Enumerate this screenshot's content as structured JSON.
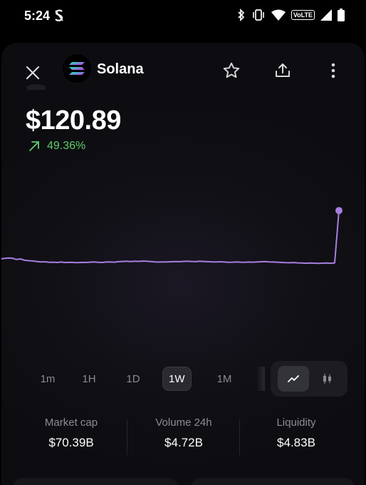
{
  "status_bar": {
    "time": "5:24",
    "volte": "VoLTE"
  },
  "header": {
    "token_name": "Solana",
    "icons": [
      "close-icon",
      "solana-logo-icon",
      "star-icon",
      "share-icon",
      "more-vertical-icon"
    ]
  },
  "price": {
    "value": "$120.89",
    "change": "49.36%",
    "change_direction": "up",
    "change_color": "#5fcf6b"
  },
  "chart_data": {
    "type": "line",
    "series_color": "#a77ee0",
    "points": [
      0.935,
      0.94,
      0.945,
      0.943,
      0.93,
      0.936,
      0.922,
      0.918,
      0.915,
      0.91,
      0.905,
      0.907,
      0.902,
      0.903,
      0.9,
      0.904,
      0.899,
      0.902,
      0.9,
      0.898,
      0.901,
      0.9,
      0.903,
      0.905,
      0.902,
      0.9,
      0.904,
      0.906,
      0.903,
      0.908,
      0.91,
      0.912,
      0.909,
      0.913,
      0.911,
      0.914,
      0.912,
      0.909,
      0.906,
      0.904,
      0.906,
      0.905,
      0.907,
      0.909,
      0.908,
      0.911,
      0.913,
      0.91,
      0.909,
      0.912,
      0.91,
      0.908,
      0.906,
      0.905,
      0.907,
      0.904,
      0.902,
      0.903,
      0.905,
      0.903,
      0.902,
      0.904,
      0.903,
      0.905,
      0.907,
      0.909,
      0.906,
      0.904,
      0.903,
      0.9,
      0.898,
      0.897,
      0.899,
      0.896,
      0.894,
      0.892,
      0.895,
      0.893,
      0.891,
      0.893,
      0.895,
      0.892,
      0.896,
      1.42
    ]
  },
  "ranges": {
    "items": [
      "1m",
      "1H",
      "1D",
      "1W",
      "1M"
    ],
    "active": "1W"
  },
  "chart_type": {
    "active": "line",
    "icons": [
      "line-chart-icon",
      "candlestick-icon"
    ]
  },
  "stats": {
    "market_cap_label": "Market cap",
    "market_cap_value": "$70.39B",
    "volume_label": "Volume 24h",
    "volume_value": "$4.72B",
    "liquidity_label": "Liquidity",
    "liquidity_value": "$4.83B"
  }
}
